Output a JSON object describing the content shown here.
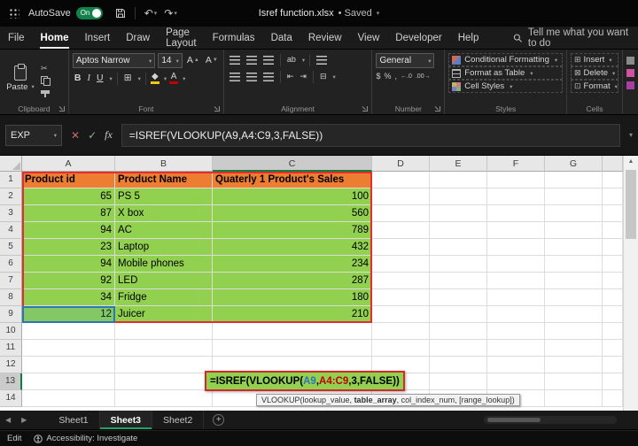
{
  "colors": {
    "excel_green": "#107C41",
    "header_orange": "#ED7D31",
    "cell_green": "#92D050",
    "ref_blue": "#2E75B6",
    "ref_red": "#C00000",
    "annotation_red": "#E42D2D"
  },
  "titlebar": {
    "autosave_label": "AutoSave",
    "autosave_state": "On",
    "title": "Isref function.xlsx",
    "saved_status": "• Saved"
  },
  "menu": {
    "tabs": [
      "File",
      "Home",
      "Insert",
      "Draw",
      "Page Layout",
      "Formulas",
      "Data",
      "Review",
      "View",
      "Developer",
      "Help"
    ],
    "active_tab": "Home",
    "search_label": "Tell me what you want to do"
  },
  "ribbon": {
    "clipboard": {
      "title": "Clipboard",
      "paste_label": "Paste"
    },
    "font": {
      "title": "Font",
      "name": "Aptos Narrow",
      "size": "14"
    },
    "alignment": {
      "title": "Alignment",
      "orientation_glyph": "ab"
    },
    "number": {
      "title": "Number",
      "format": "General",
      "icons": [
        "$",
        "%",
        ",",
        "←.0",
        ".00→"
      ]
    },
    "styles": {
      "title": "Styles",
      "items": [
        "Conditional Formatting",
        "Format as Table",
        "Cell Styles"
      ]
    },
    "cells": {
      "title": "Cells",
      "items": [
        "Insert",
        "Delete",
        "Format"
      ],
      "item_icons": [
        "⊞",
        "⊠",
        "⊡"
      ]
    }
  },
  "formula_bar": {
    "name_box": "EXP",
    "formula": "=ISREF(VLOOKUP(A9,A4:C9,3,FALSE))"
  },
  "grid": {
    "columns": [
      "A",
      "B",
      "C",
      "D",
      "E",
      "F",
      "G",
      ""
    ],
    "row_count": 14,
    "active_col": "C",
    "active_row": 13,
    "cells": {
      "1": {
        "A": "Product id",
        "B": "Product Name",
        "C": "Quaterly 1 Product's Sales"
      },
      "2": {
        "A": "65",
        "B": "PS 5",
        "C": "100"
      },
      "3": {
        "A": "87",
        "B": "X box",
        "C": "560"
      },
      "4": {
        "A": "94",
        "B": "AC",
        "C": "789"
      },
      "5": {
        "A": "23",
        "B": "Laptop",
        "C": "432"
      },
      "6": {
        "A": "94",
        "B": "Mobile phones",
        "C": "234"
      },
      "7": {
        "A": "92",
        "B": "LED",
        "C": "287"
      },
      "8": {
        "A": "34",
        "B": "Fridge",
        "C": "180"
      },
      "9": {
        "A": "12",
        "B": "Juicer",
        "C": "210"
      }
    }
  },
  "formula_overlay": {
    "parts": [
      {
        "text": "=ISREF(VLOOKUP(",
        "color": "#000000"
      },
      {
        "text": "A9",
        "color": "#2E75B6"
      },
      {
        "text": ",",
        "color": "#000000"
      },
      {
        "text": "A4:C9",
        "color": "#C00000"
      },
      {
        "text": ",3,FALSE",
        "color": "#000000"
      },
      {
        "text": "))",
        "color": "#000000"
      }
    ],
    "tooltip_parts": [
      {
        "text": "VLOOKUP(lookup_value, ",
        "bold": false
      },
      {
        "text": "table_array",
        "bold": true
      },
      {
        "text": ", col_index_num, [range_lookup])",
        "bold": false
      }
    ]
  },
  "sheet_bar": {
    "tabs": [
      "Sheet1",
      "Sheet3",
      "Sheet2"
    ],
    "active": "Sheet3"
  },
  "status_bar": {
    "mode": "Edit",
    "accessibility": "Accessibility: Investigate"
  }
}
